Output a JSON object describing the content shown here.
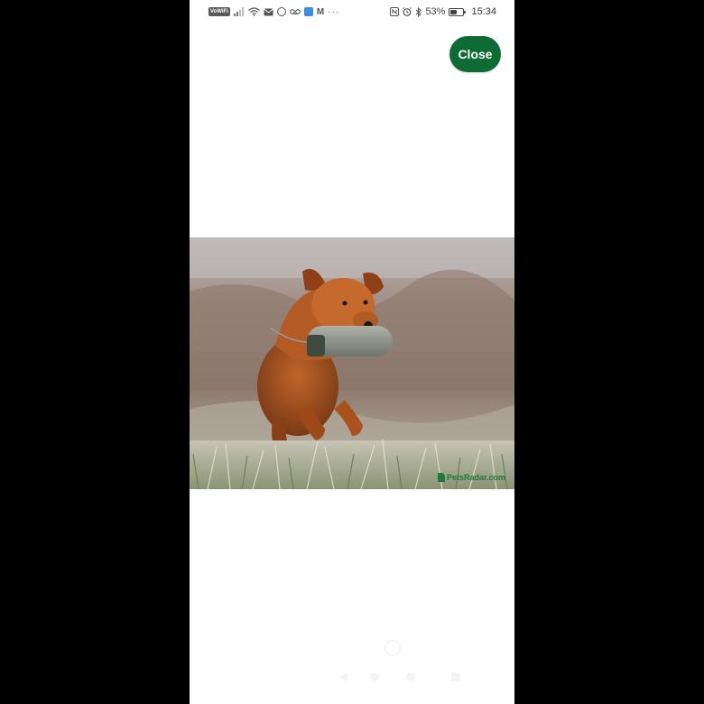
{
  "status_bar": {
    "carrier_badge": "VoWiFi",
    "battery_percent": "53%",
    "battery_level": 0.53,
    "time": "15:34",
    "overflow": "···",
    "left_icons": [
      "signal-icon",
      "wifi-icon",
      "mail-icon",
      "sync-icon",
      "voicemail-icon",
      "cloud-app-icon",
      "gmail-icon"
    ],
    "right_icons": [
      "nfc-icon",
      "alarm-icon",
      "bluetooth-icon",
      "battery-icon"
    ]
  },
  "viewer": {
    "close_label": "Close",
    "image_description_icon": "dog-photo",
    "watermark": "PetsRadar.com"
  },
  "colors": {
    "close_button_bg": "#0e6b33",
    "page_background": "#000000",
    "screen_background": "#ffffff"
  }
}
